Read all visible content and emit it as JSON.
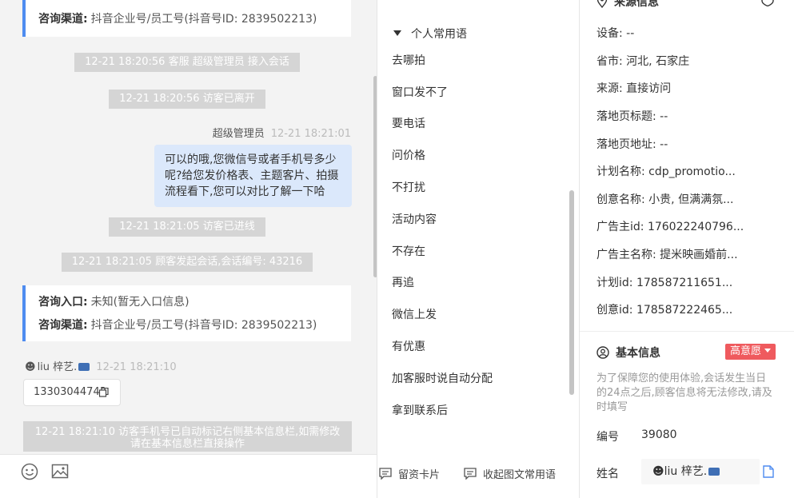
{
  "chat": {
    "card_top": {
      "channel_label": "咨询渠道:",
      "channel_value": "抖音企业号/员工号(抖音号ID: 2839502213)"
    },
    "system_events": [
      "12-21 18:20:56 客服 超级管理员 接入会话",
      "12-21 18:20:56 访客已离开"
    ],
    "agent_name": "超级管理员",
    "agent_time": "12-21 18:21:01",
    "agent_message": "可以的哦,您微信号或者手机号多少呢?给您发价格表、主题客片、拍摄流程看下,您可以对比了解一下哈",
    "system_events_2": [
      "12-21 18:21:05 访客已进线",
      "12-21 18:21:05 顾客发起会话,会话编号: 43216"
    ],
    "card_bottom": {
      "entry_label": "咨询入口:",
      "entry_value": "未知(暂无入口信息)",
      "channel_label": "咨询渠道:",
      "channel_value": "抖音企业号/员工号(抖音号ID: 2839502213)"
    },
    "visitor_name": "liu 梓艺.",
    "visitor_time": "12-21 18:21:10",
    "visitor_phone": "13303044743",
    "system_notice": "12-21 18:21:10 访客手机号已自动标记右侧基本信息栏,如需修改请在基本信息栏直接操作"
  },
  "phrases": {
    "header": "个人常用语",
    "items": [
      "去哪拍",
      "窗口发不了",
      "要电话",
      "问价格",
      "不打扰",
      "活动内容",
      "不存在",
      "再追",
      "微信上发",
      "有优惠",
      "加客服时说自动分配",
      "拿到联系后"
    ],
    "btn_card": "留资卡片",
    "btn_collapse": "收起图文常用语"
  },
  "info": {
    "source_title": "来源信息",
    "rows": [
      "设备: --",
      "省市: 河北, 石家庄",
      "来源: 直接访问",
      "落地页标题: --",
      "落地页地址: --",
      "计划名称: cdp_promotio...",
      "创意名称: 小贵, 但满满氛...",
      "广告主id: 176022240796...",
      "广告主名称: 提米映画婚前...",
      "计划id: 178587211651...",
      "创意id: 178587222465..."
    ],
    "basic_title": "基本信息",
    "badge": "高意愿",
    "notice": "为了保障您的使用体验,会话发生当日的24点之后,顾客信息将无法修改,请及时填写",
    "id_label": "编号",
    "id_value": "39080",
    "name_label": "姓名",
    "name_value": "liu 梓艺."
  },
  "colors": {
    "accent": "#4e8cf0",
    "badge": "#ef5a5e",
    "bubble": "#dbe8fb",
    "system": "#d5d5d5"
  }
}
